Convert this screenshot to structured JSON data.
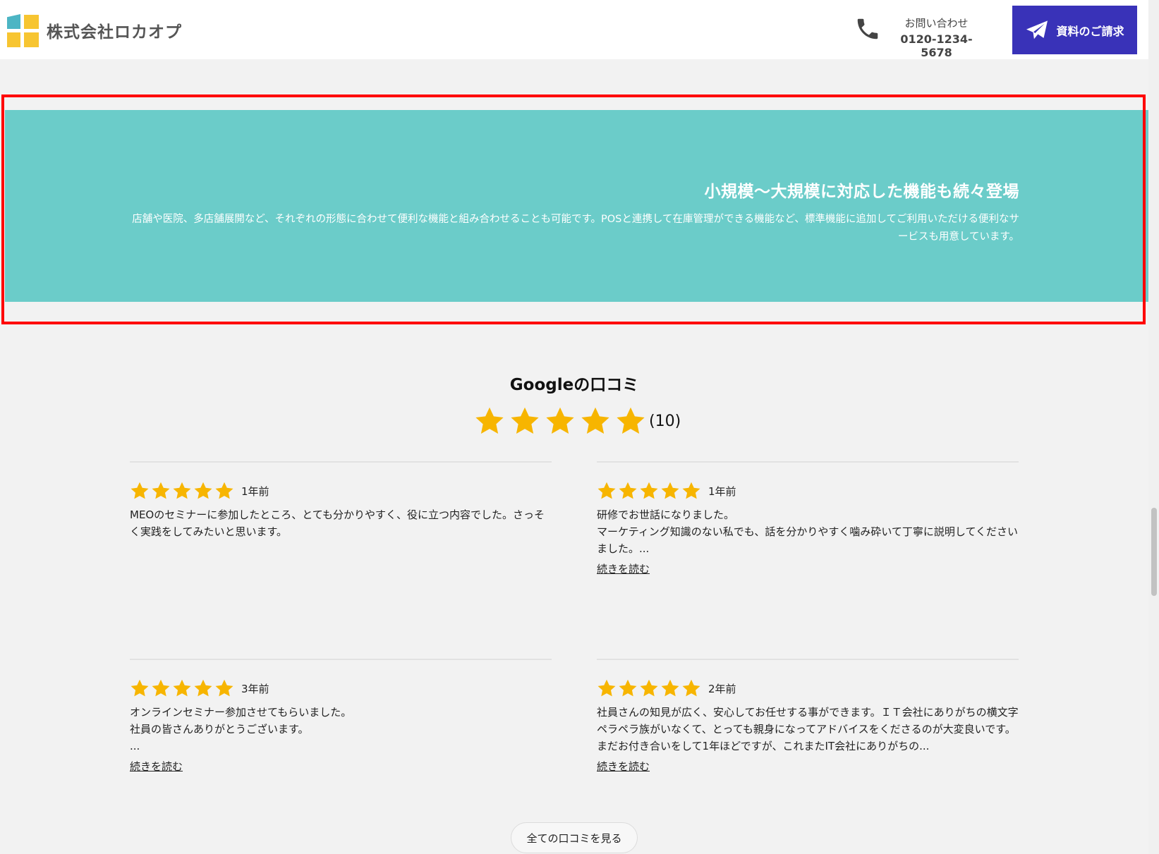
{
  "header": {
    "company_name": "株式会社ロカオプ",
    "contact_label": "お問い合わせ",
    "contact_number": "0120-1234-5678",
    "request_button_label": "資料のご請求",
    "icons": [
      "logo-mark",
      "phone-icon",
      "paper-plane-icon"
    ]
  },
  "banner": {
    "title": "小規模〜大規模に対応した機能も続々登場",
    "text": "店舗や医院、多店舗展開など、それぞれの形態に合わせて便利な機能と組み合わせることも可能です。POSと連携して在庫管理ができる機能など、標準機能に追加してご利用いただける便利なサービスも用意しています。",
    "color": "#6bccc9"
  },
  "reviews": {
    "title": "Googleの口コミ",
    "overall_rating": 5,
    "overall_count": "(10)",
    "star_color": "#f7b500",
    "items": [
      {
        "rating": 5,
        "time": "1年前",
        "text": "MEOのセミナーに参加したところ、とても分かりやすく、役に立つ内容でした。さっそく実践をしてみたいと思います。",
        "read_more": ""
      },
      {
        "rating": 5,
        "time": "1年前",
        "text": "研修でお世話になりました。\nマーケティング知識のない私でも、話を分かりやすく噛み砕いて丁寧に説明してくださいました。...",
        "read_more": "続きを読む"
      },
      {
        "rating": 5,
        "time": "3年前",
        "text": "オンラインセミナー参加させてもらいました。\n社員の皆さんありがとうございます。\n...",
        "read_more": "続きを読む"
      },
      {
        "rating": 5,
        "time": "2年前",
        "text": "社員さんの知見が広く、安心してお任せする事ができます。ＩＴ会社にありがちの横文字ペラペラ族がいなくて、とっても親身になってアドバイスをくださるのが大変良いです。まだお付き合いをして1年ほどですが、これまたIT会社にありがちの...",
        "read_more": "続きを読む"
      }
    ],
    "all_reviews_button": "全ての口コミを見る"
  },
  "accent_colors": {
    "request_button": "#3932b8",
    "highlight_box": "#ff0000"
  }
}
